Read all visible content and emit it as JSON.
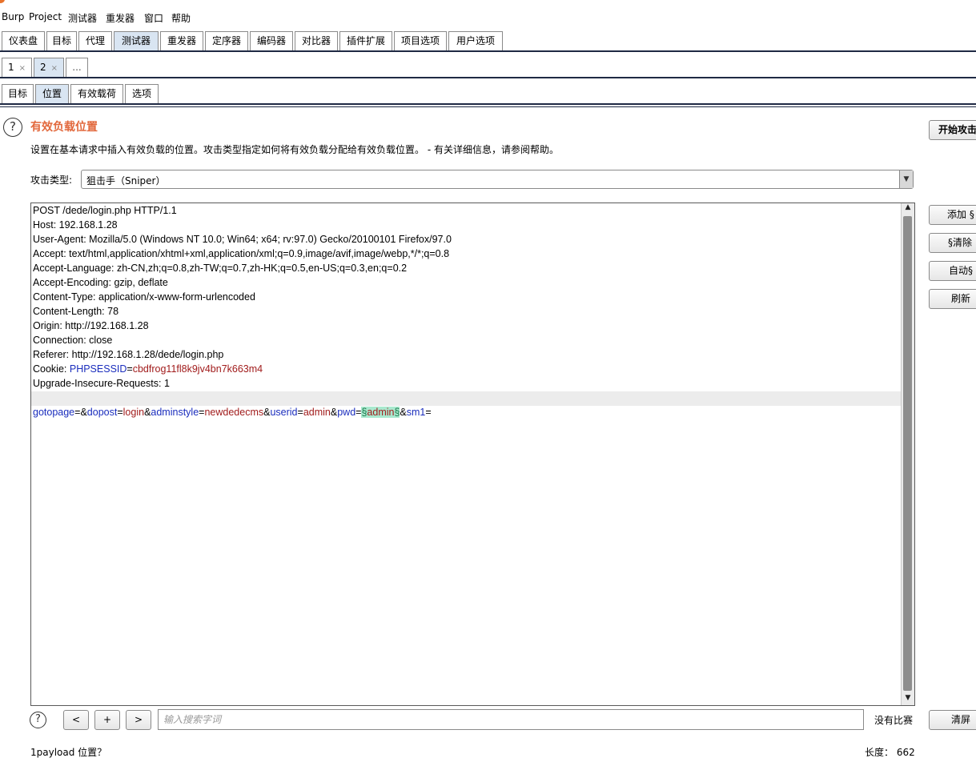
{
  "menubar": [
    "Burp",
    "Project",
    "测试器",
    "重发器",
    "窗口",
    "帮助"
  ],
  "main_tabs": [
    "仪表盘",
    "目标",
    "代理",
    "测试器",
    "重发器",
    "定序器",
    "编码器",
    "对比器",
    "插件扩展",
    "项目选项",
    "用户选项"
  ],
  "main_tab_selected": "测试器",
  "attack_tabs": [
    {
      "label": "1",
      "close": "×"
    },
    {
      "label": "2",
      "close": "×"
    }
  ],
  "attack_tab_more": "...",
  "sub_tabs": [
    "目标",
    "位置",
    "有效载荷",
    "选项"
  ],
  "sub_tab_selected": "位置",
  "help_glyph": "?",
  "section": {
    "title": "有效负载位置",
    "description": "设置在基本请求中插入有效负载的位置。攻击类型指定如何将有效负载分配给有效负载位置。 - 有关详细信息，请参阅帮助。"
  },
  "attack_type": {
    "label": "攻击类型:",
    "value": "狙击手（Sniper）"
  },
  "buttons": {
    "start_attack": "开始攻击",
    "add": "添加 §",
    "clear": "§清除",
    "auto": "自动§",
    "refresh": "刷新",
    "clear_bottom": "清屏"
  },
  "request_lines": [
    "POST /dede/login.php HTTP/1.1",
    "Host: 192.168.1.28",
    "User-Agent: Mozilla/5.0 (Windows NT 10.0; Win64; x64; rv:97.0) Gecko/20100101 Firefox/97.0",
    "Accept: text/html,application/xhtml+xml,application/xml;q=0.9,image/avif,image/webp,*/*;q=0.8",
    "Accept-Language: zh-CN,zh;q=0.8,zh-TW;q=0.7,zh-HK;q=0.5,en-US;q=0.3,en;q=0.2",
    "Accept-Encoding: gzip, deflate",
    "Content-Type: application/x-www-form-urlencoded",
    "Content-Length: 78",
    "Origin: http://192.168.1.28",
    "Connection: close",
    "Referer: http://192.168.1.28/dede/login.php"
  ],
  "cookie": {
    "prefix": "Cookie: ",
    "name": "PHPSESSID",
    "eq": "=",
    "value": "cbdfrog11fl8k9jv4bn7k663m4"
  },
  "upgrade_line": "Upgrade-Insecure-Requests: 1",
  "body_params": [
    {
      "key": "gotopage",
      "value": ""
    },
    {
      "key": "dopost",
      "value": "login"
    },
    {
      "key": "adminstyle",
      "value": "newdedecms"
    },
    {
      "key": "userid",
      "value": "admin"
    },
    {
      "key": "pwd",
      "value": "admin",
      "marked": true
    },
    {
      "key": "sm1",
      "value": ""
    }
  ],
  "payload_marker": "§",
  "search": {
    "prev": "<",
    "add": "+",
    "next": ">",
    "placeholder": "输入搜索字词",
    "matches": "没有比赛"
  },
  "status": {
    "positions": "1payload 位置？",
    "length_label": "长度：",
    "length_value": "662"
  }
}
